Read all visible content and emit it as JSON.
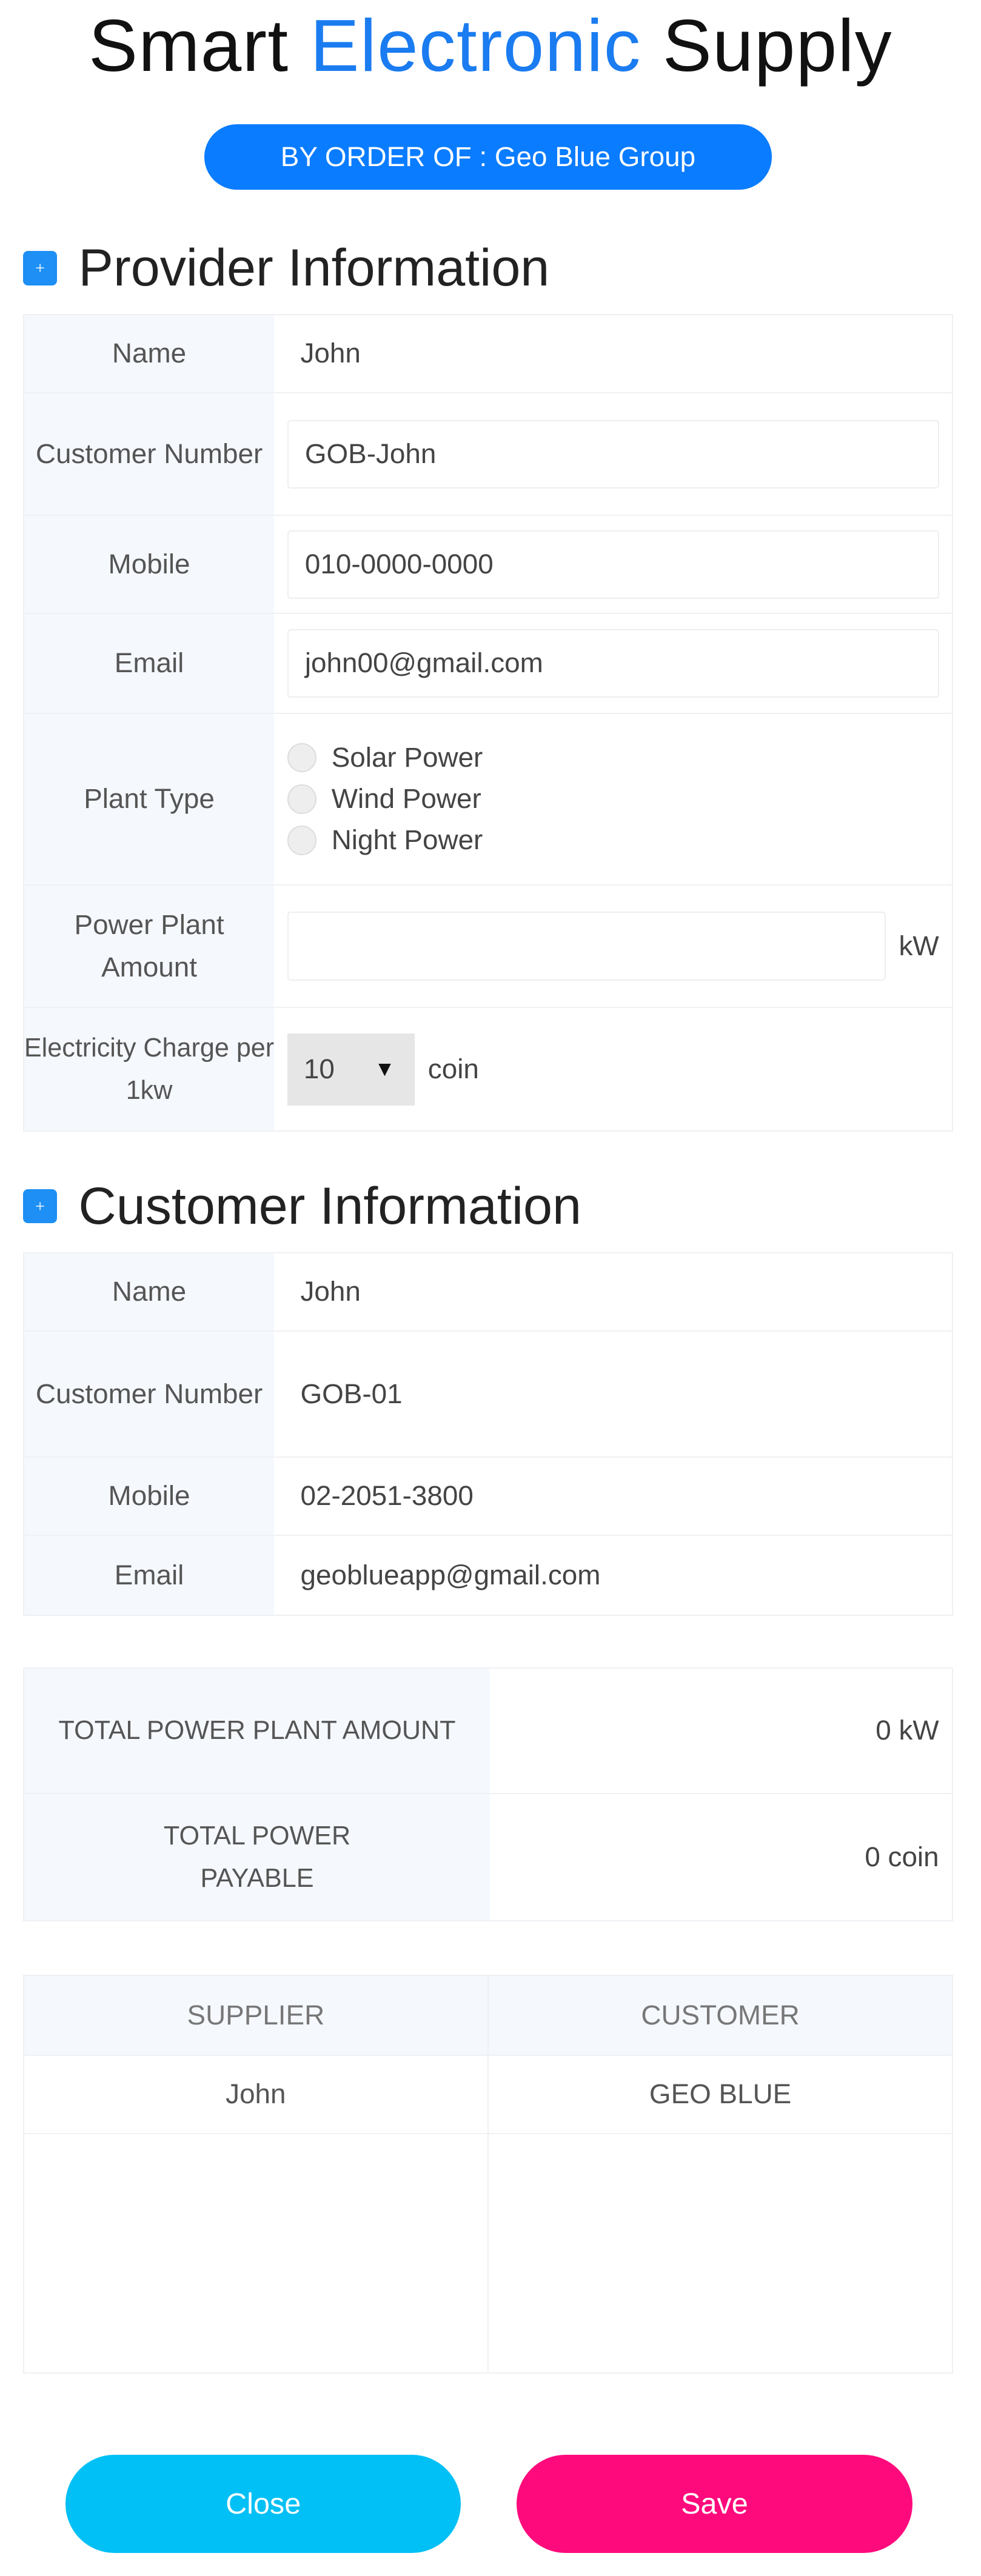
{
  "header": {
    "title_part1": "Smart",
    "title_accent": "Electronic",
    "title_part2": "Supply",
    "order_badge": "BY ORDER OF : Geo Blue Group"
  },
  "provider": {
    "section_title": "Provider Information",
    "name_label": "Name",
    "name_value": "John",
    "customer_number_label": "Customer Number",
    "customer_number_value": "GOB-John",
    "mobile_label": "Mobile",
    "mobile_value": "010-0000-0000",
    "email_label": "Email",
    "email_value": "john00@gmail.com",
    "plant_type_label": "Plant Type",
    "plant_types": [
      "Solar Power",
      "Wind Power",
      "Night Power"
    ],
    "amount_label": "Power Plant Amount",
    "amount_value": "",
    "amount_unit": "kW",
    "charge_label": "Electricity Charge per 1kw",
    "charge_value": "10",
    "charge_unit": "coin"
  },
  "customer": {
    "section_title": "Customer Information",
    "name_label": "Name",
    "name_value": "John",
    "customer_number_label": "Customer Number",
    "customer_number_value": "GOB-01",
    "mobile_label": "Mobile",
    "mobile_value": "02-2051-3800",
    "email_label": "Email",
    "email_value": "geoblueapp@gmail.com"
  },
  "totals": {
    "amount_label": "TOTAL POWER PLANT AMOUNT",
    "amount_value": "0 kW",
    "payable_label": "TOTAL POWER PAYABLE",
    "payable_value": "0 coin"
  },
  "parties": {
    "supplier_header": "SUPPLIER",
    "customer_header": "CUSTOMER",
    "supplier_value": "John",
    "customer_value": "GEO BLUE"
  },
  "actions": {
    "close_label": "Close",
    "save_label": "Save"
  },
  "colors": {
    "accent": "#0a7cff",
    "close": "#00c0f5",
    "save": "#ff0a7c"
  }
}
